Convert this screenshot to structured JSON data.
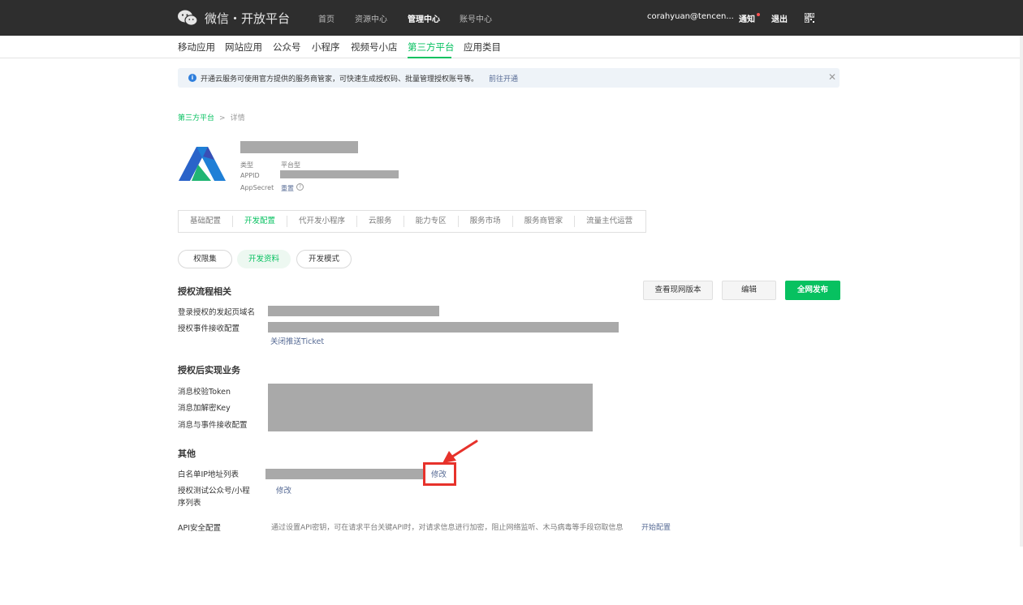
{
  "topbar": {
    "brand": "微信・开放平台",
    "nav": [
      "首页",
      "资源中心",
      "管理中心",
      "账号中心"
    ],
    "active_nav": "管理中心",
    "user": "corahyuan@tencen...",
    "notify": "通知",
    "logout": "退出"
  },
  "subnav": {
    "items": [
      "移动应用",
      "网站应用",
      "公众号",
      "小程序",
      "视频号小店",
      "第三方平台",
      "应用类目"
    ],
    "active": "第三方平台"
  },
  "notice": {
    "text": "开通云服务可使用官方提供的服务商管家，可快速生成授权码、批量管理授权账号等。",
    "link": "前往开通"
  },
  "breadcrumb": {
    "root": "第三方平台",
    "separator": ">",
    "current": "详情"
  },
  "app": {
    "type_label": "类型",
    "type_value": "平台型",
    "appid_label": "APPID",
    "secret_label": "AppSecret",
    "reset": "重置",
    "help": "?"
  },
  "tabs": [
    "基础配置",
    "开发配置",
    "代开发小程序",
    "云服务",
    "能力专区",
    "服务市场",
    "服务商管家",
    "流量主代运营"
  ],
  "active_tab": "开发配置",
  "subtabs": [
    "权限集",
    "开发资料",
    "开发模式"
  ],
  "active_subtab": "开发资料",
  "buttons": {
    "view_current": "查看现网版本",
    "edit": "编辑",
    "publish": "全网发布"
  },
  "auth_flow": {
    "title": "授权流程相关",
    "domain_label": "登录授权的发起页域名",
    "event_label": "授权事件接收配置",
    "close_ticket": "关闭推送Ticket"
  },
  "post_auth": {
    "title": "授权后实现业务",
    "token_label": "消息校验Token",
    "key_label": "消息加解密Key",
    "event_url_label": "消息与事件接收配置"
  },
  "other": {
    "title": "其他",
    "whitelist_label": "白名单IP地址列表",
    "whitelist_edit": "修改",
    "test_list_label_1": "授权测试公众号/小程",
    "test_list_label_2": "序列表",
    "test_list_edit": "修改",
    "api_label": "API安全配置",
    "api_desc": "通过设置API密钥，可在请求平台关键API时，对请求信息进行加密，阻止网络监听、木马病毒等手段窃取信息",
    "api_link": "开始配置"
  },
  "colors": {
    "accent": "#07c160",
    "link": "#576b95",
    "highlight": "#e7322b",
    "topbar": "#2e2e2e"
  }
}
